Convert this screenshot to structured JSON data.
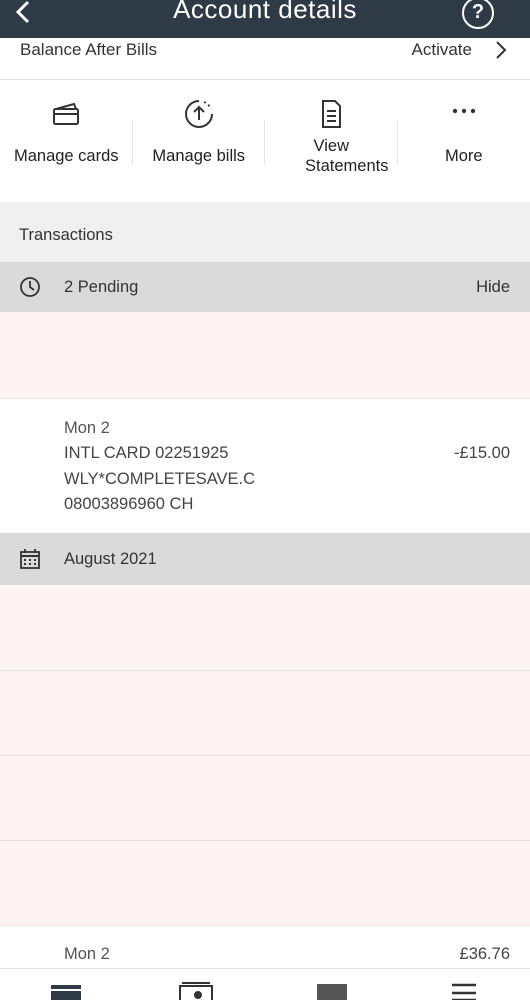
{
  "header": {
    "title": "Account details",
    "back_icon": "chevron-left-icon",
    "help_label": "?"
  },
  "balance_after_bills": {
    "label": "Balance After Bills",
    "action_label": "Activate"
  },
  "actions": [
    {
      "label": "Manage cards",
      "icon": "card-icon"
    },
    {
      "label": "Manage bills",
      "icon": "bills-upload-icon"
    },
    {
      "label": "View Statements",
      "icon": "document-icon"
    },
    {
      "label": "More",
      "icon": "more-dots-icon"
    }
  ],
  "transactions": {
    "title": "Transactions",
    "pending": {
      "label": "2 Pending",
      "toggle": "Hide"
    },
    "pending_item": {
      "date": "Mon 2",
      "lines": [
        "INTL CARD 02251925",
        "WLY*COMPLETESAVE.C",
        "08003896960 CH"
      ],
      "amount": "-£15.00"
    },
    "month": {
      "label": "August 2021"
    },
    "last_item": {
      "date": "Mon 2",
      "amount": "£36.76"
    }
  },
  "tabbar": [
    "accounts-tab-icon",
    "payments-tab-icon",
    "messages-tab-icon",
    "menu-tab-icon"
  ]
}
